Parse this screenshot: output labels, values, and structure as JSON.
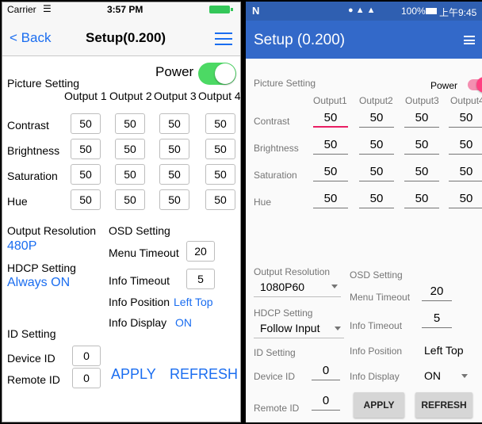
{
  "ios": {
    "status": {
      "carrier": "Carrier",
      "time": "3:57 PM"
    },
    "nav": {
      "back": "< Back",
      "title": "Setup(0.200)"
    },
    "power_label": "Power",
    "picture_setting": "Picture Setting",
    "outputs": [
      "Output 1",
      "Output 2",
      "Output 3",
      "Output 4"
    ],
    "rows": [
      {
        "label": "Contrast",
        "values": [
          "50",
          "50",
          "50",
          "50"
        ]
      },
      {
        "label": "Brightness",
        "values": [
          "50",
          "50",
          "50",
          "50"
        ]
      },
      {
        "label": "Saturation",
        "values": [
          "50",
          "50",
          "50",
          "50"
        ]
      },
      {
        "label": "Hue",
        "values": [
          "50",
          "50",
          "50",
          "50"
        ]
      }
    ],
    "output_resolution": {
      "label": "Output Resolution",
      "value": "480P"
    },
    "hdcp": {
      "label": "HDCP Setting",
      "value": "Always ON"
    },
    "osd": {
      "label": "OSD Setting",
      "menu_timeout_label": "Menu Timeout",
      "menu_timeout": "20",
      "info_timeout_label": "Info Timeout",
      "info_timeout": "5",
      "info_position_label": "Info Position",
      "info_position": "Left Top",
      "info_display_label": "Info Display",
      "info_display": "ON"
    },
    "id_setting": "ID Setting",
    "device_id_label": "Device ID",
    "device_id": "0",
    "remote_id_label": "Remote ID",
    "remote_id": "0",
    "apply": "APPLY",
    "refresh": "REFRESH"
  },
  "android": {
    "status": {
      "n": "N",
      "battery": "100%",
      "time": "上午9:45"
    },
    "title": "Setup (0.200)",
    "picture_setting": "Picture Setting",
    "power_label": "Power",
    "outputs": [
      "Output1",
      "Output2",
      "Output3",
      "Output4"
    ],
    "rows": [
      {
        "label": "Contrast",
        "values": [
          "50",
          "50",
          "50",
          "50"
        ]
      },
      {
        "label": "Brightness",
        "values": [
          "50",
          "50",
          "50",
          "50"
        ]
      },
      {
        "label": "Saturation",
        "values": [
          "50",
          "50",
          "50",
          "50"
        ]
      },
      {
        "label": "Hue",
        "values": [
          "50",
          "50",
          "50",
          "50"
        ]
      }
    ],
    "output_resolution": {
      "label": "Output Resolution",
      "value": "1080P60"
    },
    "hdcp": {
      "label": "HDCP Setting",
      "value": "Follow Input"
    },
    "osd": {
      "label": "OSD Setting",
      "menu_timeout_label": "Menu Timeout",
      "menu_timeout": "20",
      "info_timeout_label": "Info Timeout",
      "info_timeout": "5",
      "info_position_label": "Info Position",
      "info_position": "Left Top",
      "info_display_label": "Info Display",
      "info_display": "ON"
    },
    "id_setting": "ID Setting",
    "device_id_label": "Device ID",
    "device_id": "0",
    "remote_id_label": "Remote ID",
    "remote_id": "0",
    "apply": "APPLY",
    "refresh": "REFRESH"
  },
  "colors": {
    "ios_accent": "#1a6df0",
    "ios_switch": "#4cd964",
    "android_primary": "#3369c9",
    "android_accent": "#ff4081"
  }
}
